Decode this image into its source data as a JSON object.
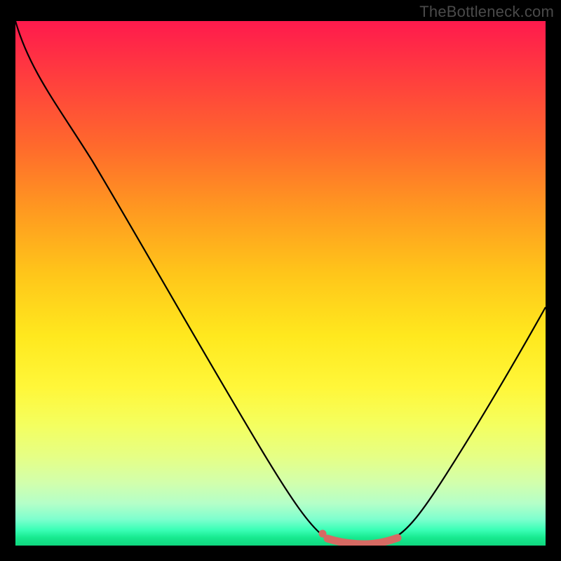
{
  "watermark": "TheBottleneck.com",
  "colors": {
    "background": "#000000",
    "curve_stroke": "#000000",
    "marker_stroke": "#d66a63",
    "marker_fill": "#d66a63",
    "gradient_top": "#ff1a4d",
    "gradient_bottom": "#0fd77f"
  },
  "chart_data": {
    "type": "line",
    "title": "",
    "xlabel": "",
    "ylabel": "",
    "xlim": [
      0,
      100
    ],
    "ylim": [
      0,
      100
    ],
    "grid": false,
    "legend": false,
    "series": [
      {
        "name": "bottleneck-curve",
        "x": [
          0,
          5,
          10,
          15,
          20,
          25,
          30,
          35,
          40,
          45,
          50,
          55,
          58,
          60,
          62,
          65,
          68,
          70,
          73,
          76,
          80,
          85,
          90,
          95,
          100
        ],
        "y": [
          100,
          92,
          83,
          74.5,
          66,
          57.5,
          49,
          40.5,
          32,
          23.5,
          15,
          7,
          3,
          1.2,
          0.6,
          0.3,
          0.3,
          0.6,
          1.5,
          4,
          10,
          19,
          28,
          37,
          46
        ]
      }
    ],
    "markers": {
      "name": "highlight-segment",
      "x_start": 58,
      "x_end": 73,
      "note": "thick salmon segment along valley bottom with a small dot at x≈58"
    }
  }
}
